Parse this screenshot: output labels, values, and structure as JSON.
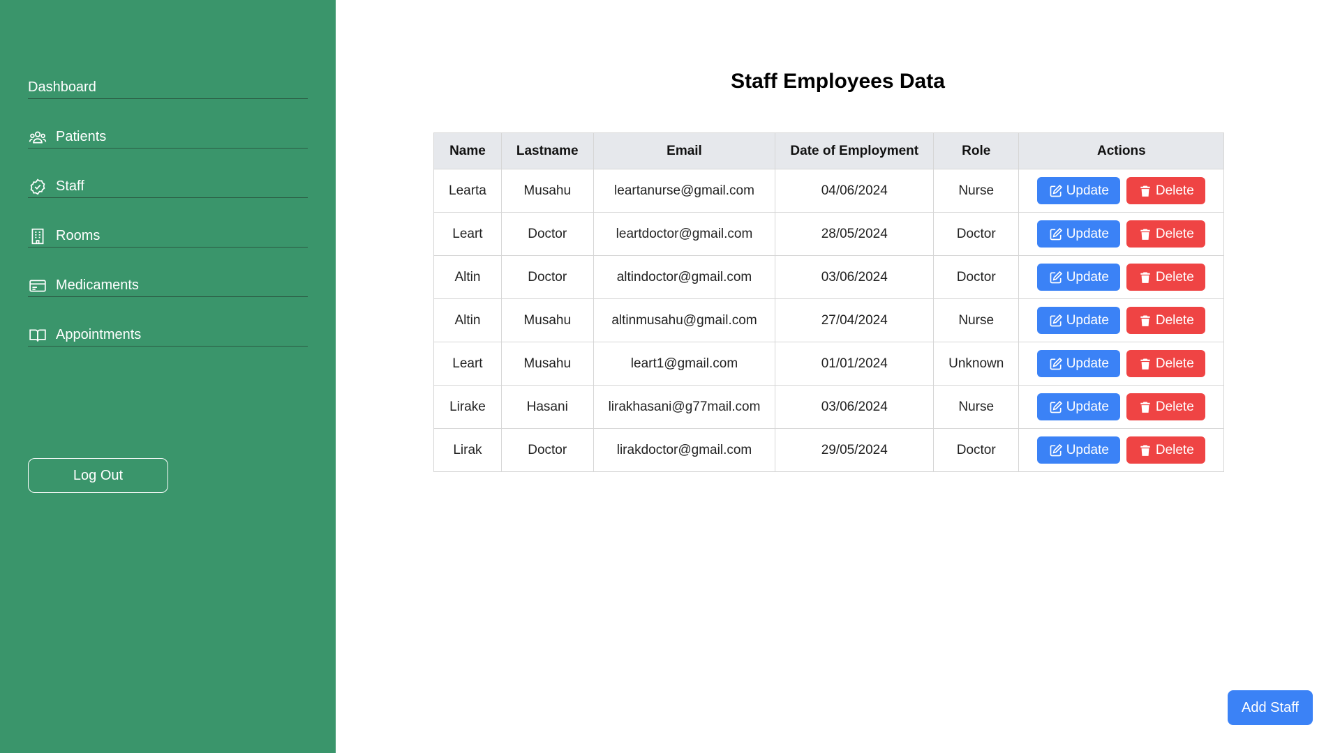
{
  "sidebar": {
    "items": [
      {
        "label": "Dashboard",
        "icon": "none"
      },
      {
        "label": "Patients",
        "icon": "users-icon"
      },
      {
        "label": "Staff",
        "icon": "badge-check-icon"
      },
      {
        "label": "Rooms",
        "icon": "building-icon"
      },
      {
        "label": "Medicaments",
        "icon": "card-icon"
      },
      {
        "label": "Appointments",
        "icon": "book-icon"
      }
    ],
    "logout_label": "Log Out"
  },
  "main": {
    "title": "Staff Employees Data",
    "table": {
      "headers": [
        "Name",
        "Lastname",
        "Email",
        "Date of Employment",
        "Role",
        "Actions"
      ],
      "rows": [
        [
          "Learta",
          "Musahu",
          "leartanurse@gmail.com",
          "04/06/2024",
          "Nurse"
        ],
        [
          "Leart",
          "Doctor",
          "leartdoctor@gmail.com",
          "28/05/2024",
          "Doctor"
        ],
        [
          "Altin",
          "Doctor",
          "altindoctor@gmail.com",
          "03/06/2024",
          "Doctor"
        ],
        [
          "Altin",
          "Musahu",
          "altinmusahu@gmail.com",
          "27/04/2024",
          "Nurse"
        ],
        [
          "Leart",
          "Musahu",
          "leart1@gmail.com",
          "01/01/2024",
          "Unknown"
        ],
        [
          "Lirake",
          "Hasani",
          "lirakhasani@g77mail.com",
          "03/06/2024",
          "Nurse"
        ],
        [
          "Lirak",
          "Doctor",
          "lirakdoctor@gmail.com",
          "29/05/2024",
          "Doctor"
        ]
      ],
      "update_label": "Update",
      "delete_label": "Delete"
    },
    "add_button_label": "Add Staff"
  },
  "colors": {
    "sidebar_bg": "#3a956b",
    "update_btn": "#3b82f6",
    "delete_btn": "#ef4444",
    "header_bg": "#e6e8ec"
  }
}
